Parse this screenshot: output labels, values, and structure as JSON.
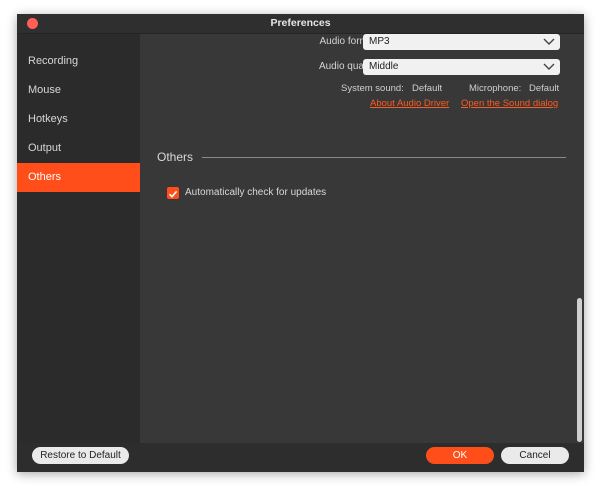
{
  "window": {
    "title": "Preferences"
  },
  "sidebar": {
    "items": [
      {
        "label": "Recording"
      },
      {
        "label": "Mouse"
      },
      {
        "label": "Hotkeys"
      },
      {
        "label": "Output"
      },
      {
        "label": "Others",
        "selected": true
      }
    ]
  },
  "audio": {
    "format_label": "Audio format:",
    "format_value": "MP3",
    "quality_label": "Audio quality:",
    "quality_value": "Middle",
    "system_sound_label": "System sound:",
    "system_sound_value": "Default",
    "microphone_label": "Microphone:",
    "microphone_value": "Default",
    "about_driver_link": "About Audio Driver",
    "sound_dialog_link": "Open the Sound dialog"
  },
  "others": {
    "section_title": "Others",
    "auto_update_label": "Automatically check for updates",
    "auto_update_checked": true
  },
  "footer": {
    "restore_label": "Restore to Default",
    "ok_label": "OK",
    "cancel_label": "Cancel"
  },
  "colors": {
    "accent": "#ff4e19",
    "link": "#ff5a1f",
    "close": "#ff5f57"
  }
}
